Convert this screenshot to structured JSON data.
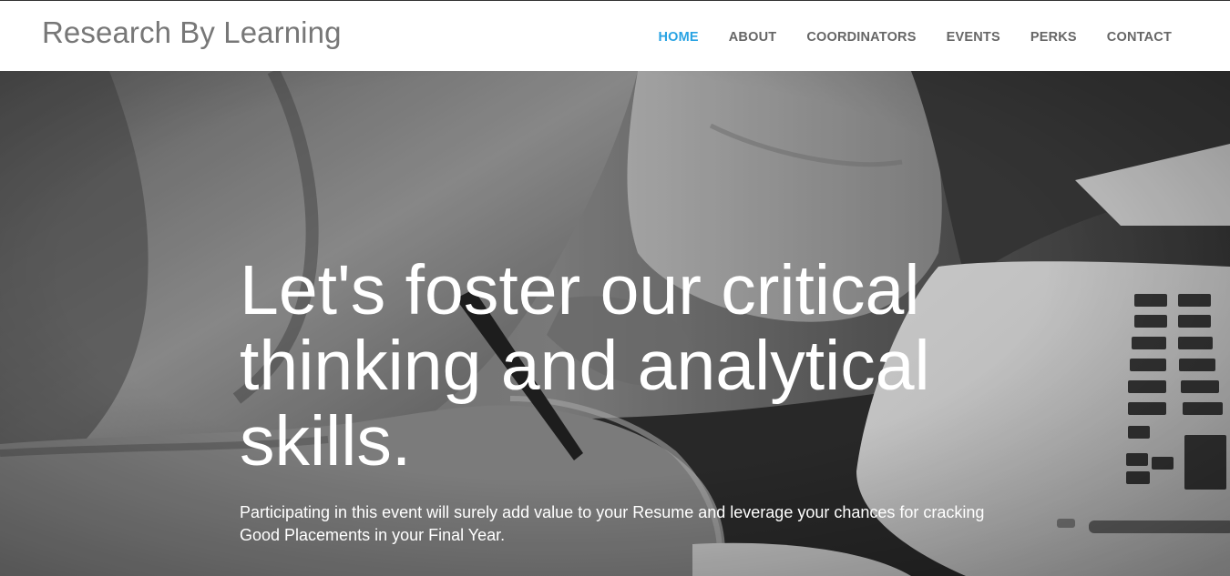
{
  "brand": "Research By Learning",
  "nav": {
    "items": [
      {
        "label": "HOME",
        "active": true
      },
      {
        "label": "ABOUT",
        "active": false
      },
      {
        "label": "COORDINATORS",
        "active": false
      },
      {
        "label": "EVENTS",
        "active": false
      },
      {
        "label": "PERKS",
        "active": false
      },
      {
        "label": "CONTACT",
        "active": false
      }
    ]
  },
  "hero": {
    "headline": "Let's foster our critical thinking and analytical skills.",
    "subtext": "Participating in this event will surely add value to your Resume and leverage your chances for cracking Good Placements in your Final Year."
  },
  "colors": {
    "accent": "#29a3e3",
    "nav_text": "#666666",
    "brand_text": "#777777"
  }
}
